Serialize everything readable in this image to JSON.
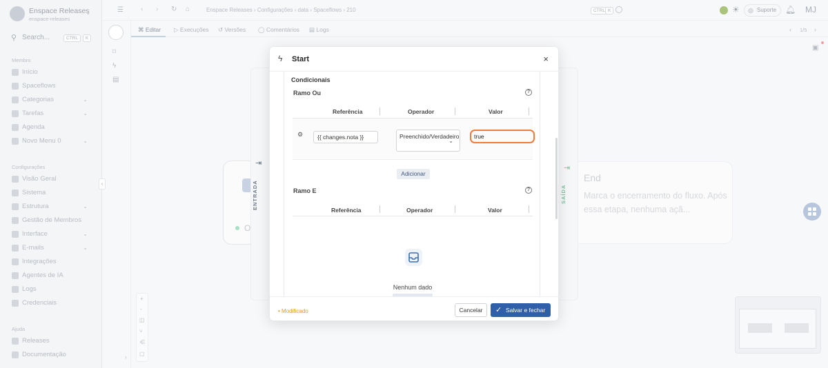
{
  "sidebar": {
    "workspace_name": "Enspace Releases",
    "workspace_slug": "enspace-releases",
    "search_label": "Search...",
    "search_kbd_1": "CTRL",
    "search_kbd_2": "K",
    "section_membro": "Membro",
    "section_config": "Configurações",
    "section_ajuda": "Ajuda",
    "items_membro": [
      "Início",
      "Spaceflows",
      "Categorias",
      "Tarefas",
      "Agenda",
      "Novo Menu 0"
    ],
    "items_config": [
      "Visão Geral",
      "Sistema",
      "Estrutura",
      "Gestão de Membros",
      "Interface",
      "E-mails",
      "Integrações",
      "Agentes de IA",
      "Logs",
      "Credenciais"
    ],
    "items_ajuda": [
      "Releases",
      "Documentação"
    ]
  },
  "topbar": {
    "breadcrumb": "Enspace Releases  ›  Configurações  ›  data  ›  Spaceflows  ›  210",
    "kbd_ctrl": "CTRL",
    "kbd_k": "K",
    "support": "Suporte",
    "avatar": "MJ"
  },
  "tabs": [
    "Editar",
    "Execuções",
    "Versões",
    "Comentários",
    "Logs"
  ],
  "pager": "1/5",
  "canvas": {
    "entrada": "ENTRADA",
    "saida": "SAÍDA",
    "end_title": "End",
    "end_desc": "Marca o encerramento do fluxo. Após essa etapa, nenhuma açã...",
    "start_partial": "O"
  },
  "modal": {
    "title": "Start",
    "close": "×",
    "condicionais": "Condicionais",
    "ramo_ou": "Ramo Ou",
    "ramo_e": "Ramo E",
    "help": "?",
    "col_referencia": "Referência",
    "col_operador": "Operador",
    "col_valor": "Valor",
    "row_reference": "{{ changes.nota }}",
    "row_operator": "Preenchido/Verdadeiro",
    "row_value": "true",
    "add_button": "Adicionar",
    "empty_text": "Nenhum dado",
    "modified": "• Modificado",
    "cancel": "Cancelar",
    "save": "Salvar e fechar"
  },
  "colors": {
    "accent": "#2f5fa8",
    "highlight": "#f07a3b",
    "modified": "#e09a2b"
  }
}
